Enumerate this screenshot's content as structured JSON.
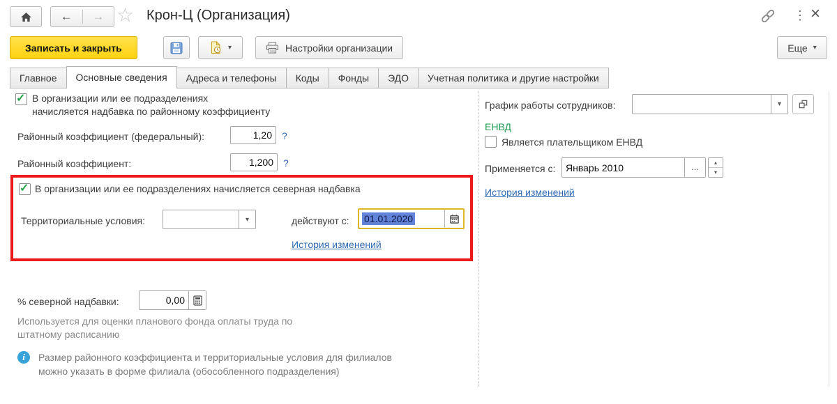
{
  "icons": {
    "check": "✓",
    "dropdown_arrow": "▾",
    "back_arrow": "←",
    "forward_arrow": "→",
    "star": "☆",
    "kebab": "⋮",
    "close": "×",
    "help": "?",
    "ellipsis": "...",
    "spin_up": "▴",
    "spin_down": "▾",
    "info": "i"
  },
  "header": {
    "title": "Крон-Ц (Организация)"
  },
  "toolbar": {
    "save_close": "Записать и закрыть",
    "org_settings": "Настройки организации",
    "more": "Еще"
  },
  "tabs": [
    {
      "label": "Главное",
      "active": false
    },
    {
      "label": "Основные сведения",
      "active": true
    },
    {
      "label": "Адреса и телефоны",
      "active": false
    },
    {
      "label": "Коды",
      "active": false
    },
    {
      "label": "Фонды",
      "active": false
    },
    {
      "label": "ЭДО",
      "active": false
    },
    {
      "label": "Учетная политика и другие настройки",
      "active": false
    }
  ],
  "left": {
    "district_allowance": {
      "checked": true,
      "label_line1": "В организации или ее подразделениях",
      "label_line2": "начисляется надбавка по районному коэффициенту"
    },
    "federal_coefficient": {
      "label": "Районный коэффициент (федеральный):",
      "value": "1,20"
    },
    "regional_coefficient": {
      "label": "Районный коэффициент:",
      "value": "1,200"
    },
    "northern_allowance": {
      "checked": true,
      "checkbox_label": "В организации или ее подразделениях начисляется северная надбавка",
      "territorial_label": "Территориальные условия:",
      "territorial_value": "",
      "effective_from_label": "действуют с:",
      "effective_from_value": "01.01.2020",
      "history_link": "История изменений"
    },
    "northern_percent": {
      "label": "% северной надбавки:",
      "value": "0,00"
    },
    "usage_note_line1": "Используется для оценки планового фонда оплаты труда по",
    "usage_note_line2": "штатному расписанию",
    "info_note_line1": "Размер районного коэффициента и территориальные условия для филиалов",
    "info_note_line2": "можно указать в форме филиала (обособленного подразделения)"
  },
  "right": {
    "work_schedule_label": "График работы сотрудников:",
    "work_schedule_value": "",
    "envd_header": "ЕНВД",
    "envd_payer_label": "Является плательщиком ЕНВД",
    "applied_from_label": "Применяется с:",
    "applied_from_value": "Январь 2010",
    "history_link": "История изменений"
  },
  "colors": {
    "accent_yellow": "#ffd312",
    "highlight_red": "#ec1a1a",
    "link_blue": "#2f6bb3",
    "green_header": "#1f9d55",
    "selection_blue": "#6183d8",
    "focus_gold": "#dcb827",
    "check_green": "#27a24a",
    "info_blue": "#38a3d8"
  }
}
